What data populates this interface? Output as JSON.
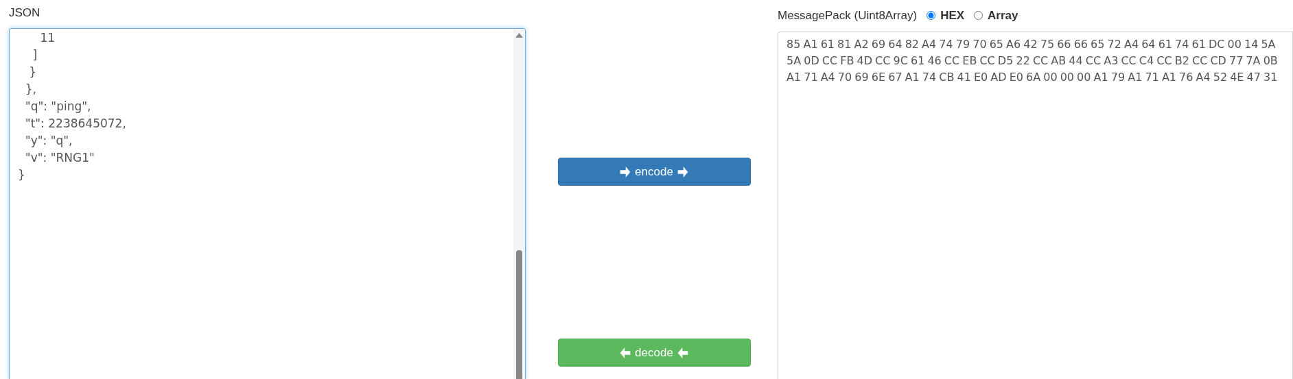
{
  "json_panel": {
    "label": "JSON",
    "value": "      11\n    ]\n   }\n  },\n  \"q\": \"ping\",\n  \"t\": 2238645072,\n  \"y\": \"q\",\n  \"v\": \"RNG1\"\n}"
  },
  "buttons": [
    {
      "kind": "encode",
      "label": "encode"
    },
    {
      "kind": "decode",
      "label": "decode"
    }
  ],
  "msgpack_panel": {
    "label": "MessagePack (Uint8Array)",
    "formats": [
      {
        "label": "HEX",
        "selected": true
      },
      {
        "label": "Array",
        "selected": false
      }
    ],
    "value": "85 A1 61 81 A2 69 64 82 A4 74 79 70 65 A6 42 75 66 66 65 72 A4 64 61 74 61 DC 00 14 5A 5A 0D CC FB 4D CC 9C 61 46 CC EB CC D5 22 CC AB 44 CC A3 CC C4 CC B2 CC CD 77 7A 0B A1 71 A4 70 69 6E 67 A1 74 CB 41 E0 AD E0 6A 00 00 00 A1 79 A1 71 A1 76 A4 52 4E 47 31"
  }
}
